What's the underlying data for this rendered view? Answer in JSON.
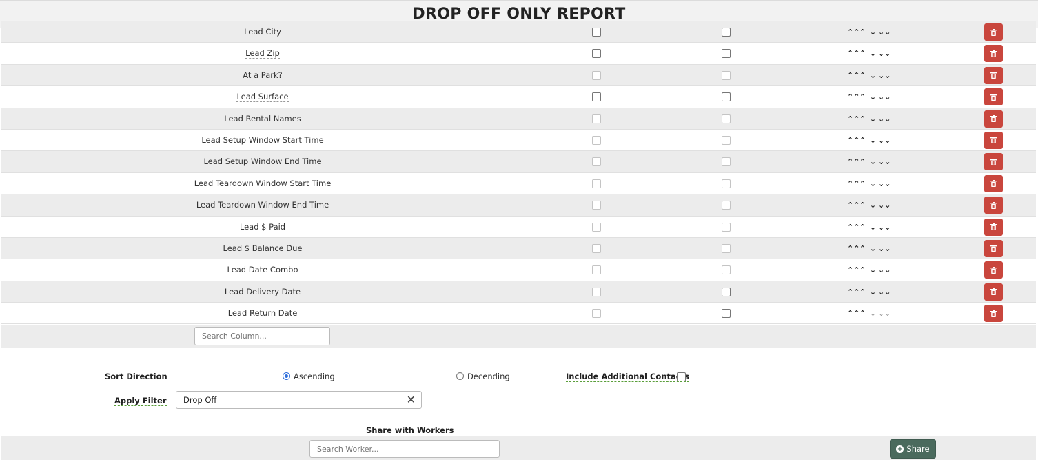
{
  "page": {
    "title": "DROP OFF ONLY REPORT"
  },
  "columns": [
    {
      "name": "Lead City",
      "dotted": true,
      "cb1": "enabled",
      "cb2": "enabled",
      "arrows_dim": []
    },
    {
      "name": "Lead Zip",
      "dotted": true,
      "cb1": "enabled",
      "cb2": "enabled",
      "arrows_dim": []
    },
    {
      "name": "At a Park?",
      "dotted": false,
      "cb1": "disabled",
      "cb2": "disabled",
      "arrows_dim": []
    },
    {
      "name": "Lead Surface",
      "dotted": true,
      "cb1": "enabled",
      "cb2": "enabled",
      "arrows_dim": []
    },
    {
      "name": "Lead Rental Names",
      "dotted": false,
      "cb1": "disabled",
      "cb2": "disabled",
      "arrows_dim": []
    },
    {
      "name": "Lead Setup Window Start Time",
      "dotted": false,
      "cb1": "disabled",
      "cb2": "disabled",
      "arrows_dim": []
    },
    {
      "name": "Lead Setup Window End Time",
      "dotted": false,
      "cb1": "disabled",
      "cb2": "disabled",
      "arrows_dim": []
    },
    {
      "name": "Lead Teardown Window Start Time",
      "dotted": false,
      "cb1": "disabled",
      "cb2": "disabled",
      "arrows_dim": []
    },
    {
      "name": "Lead Teardown Window End Time",
      "dotted": false,
      "cb1": "disabled",
      "cb2": "disabled",
      "arrows_dim": []
    },
    {
      "name": "Lead $ Paid",
      "dotted": false,
      "cb1": "disabled",
      "cb2": "disabled",
      "arrows_dim": []
    },
    {
      "name": "Lead $ Balance Due",
      "dotted": false,
      "cb1": "disabled",
      "cb2": "disabled",
      "arrows_dim": []
    },
    {
      "name": "Lead Date Combo",
      "dotted": false,
      "cb1": "disabled",
      "cb2": "disabled",
      "arrows_dim": []
    },
    {
      "name": "Lead Delivery Date",
      "dotted": false,
      "cb1": "disabled",
      "cb2": "enabled",
      "arrows_dim": []
    },
    {
      "name": "Lead Return Date",
      "dotted": false,
      "cb1": "disabled",
      "cb2": "enabled",
      "arrows_dim": [
        2,
        3
      ]
    }
  ],
  "arrow_icons": [
    "double-chevron-up-icon",
    "chevron-up-icon",
    "chevron-down-icon",
    "double-chevron-down-icon"
  ],
  "arrow_glyphs": [
    "⌃⌃",
    "⌃",
    "⌄",
    "⌄⌄"
  ],
  "search_column": {
    "placeholder": "Search Column..."
  },
  "sort": {
    "label": "Sort Direction",
    "ascending_label": "Ascending",
    "descending_label": "Decending",
    "selected": "ascending"
  },
  "include_contacts": {
    "label": "Include Additional Contacts",
    "checked": false
  },
  "filter": {
    "label": "Apply Filter",
    "value": "Drop Off",
    "clear_icon": "close-icon"
  },
  "share": {
    "heading": "Share with Workers",
    "placeholder": "Search Worker...",
    "button_label": "Share",
    "button_icon": "plus-circle-icon"
  },
  "colors": {
    "delete": "#c9463d",
    "share": "#4a6a5d",
    "accent": "#2f6fdc",
    "row_alt": "#ececec"
  }
}
